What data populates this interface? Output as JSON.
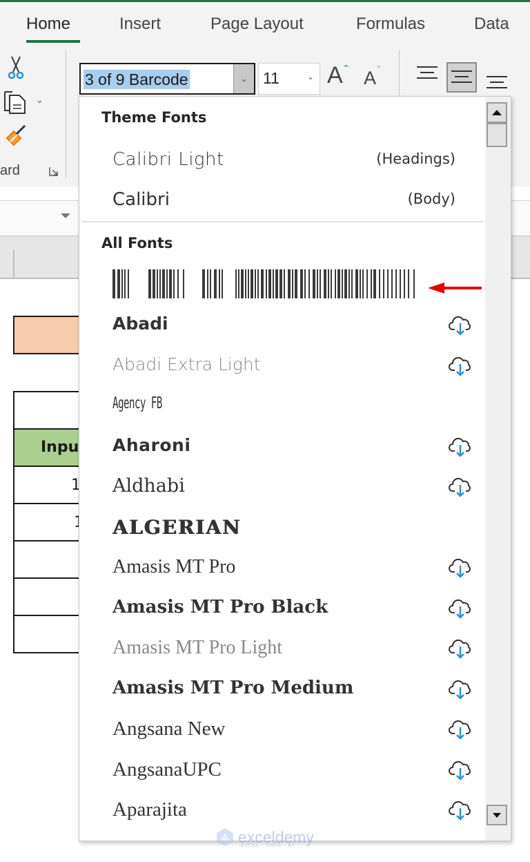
{
  "ribbon": {
    "tabs": [
      {
        "label": "Home",
        "active": true
      },
      {
        "label": "Insert",
        "active": false
      },
      {
        "label": "Page Layout",
        "active": false
      },
      {
        "label": "Formulas",
        "active": false
      },
      {
        "label": "Data",
        "active": false
      }
    ],
    "clipboard_group_label": "ard",
    "font_name_value": "3 of 9 Barcode",
    "font_size_value": "11",
    "grow_font_label": "A",
    "shrink_font_label": "A",
    "accent_color": "#217346"
  },
  "sheet": {
    "header_cell_partial_text": "Inpu",
    "rows_partial_values": [
      "1",
      "1",
      "",
      "",
      ""
    ],
    "title_fill_color": "#f8cbad",
    "header_fill_color": "#a9d08e"
  },
  "font_dropdown": {
    "theme_section_title": "Theme Fonts",
    "theme_fonts": [
      {
        "name": "Calibri Light",
        "tag": "(Headings)"
      },
      {
        "name": "Calibri",
        "tag": "(Body)"
      }
    ],
    "all_section_title": "All Fonts",
    "barcode_font_preview": "3 of 9 Barcode",
    "fonts": [
      {
        "name": "Abadi",
        "cloud": true
      },
      {
        "name": "Abadi Extra Light",
        "cloud": true
      },
      {
        "name": "Agency FB",
        "cloud": false
      },
      {
        "name": "Aharoni",
        "cloud": true
      },
      {
        "name": "Aldhabi",
        "cloud": true
      },
      {
        "name": "ALGERIAN",
        "cloud": false
      },
      {
        "name": "Amasis MT Pro",
        "cloud": true
      },
      {
        "name": "Amasis MT Pro Black",
        "cloud": true
      },
      {
        "name": "Amasis MT Pro Light",
        "cloud": true
      },
      {
        "name": "Amasis MT Pro Medium",
        "cloud": true
      },
      {
        "name": "Angsana New",
        "cloud": true
      },
      {
        "name": "AngsanaUPC",
        "cloud": true
      },
      {
        "name": "Aparajita",
        "cloud": true
      }
    ],
    "cloud_icon_color": "#2b8fd6",
    "annotation_arrow_color": "#e60000"
  },
  "watermark": {
    "brand": "exceldemy",
    "tagline": "EXCEL · DATA · BI"
  }
}
